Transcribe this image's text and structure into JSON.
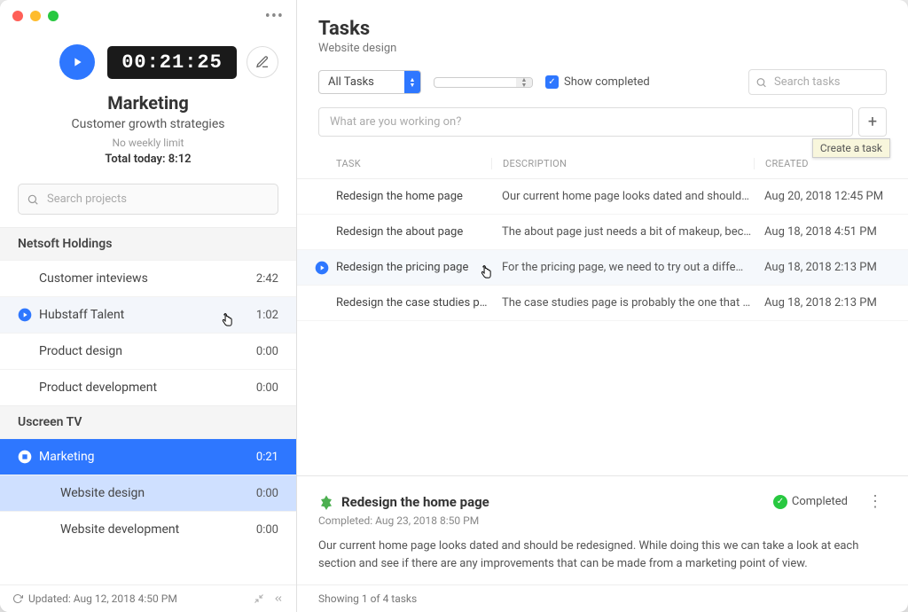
{
  "timer": {
    "display": "00:21:25"
  },
  "project_header": {
    "name": "Marketing",
    "desc": "Customer growth strategies",
    "limit": "No weekly limit",
    "total_label": "Total today: 8:12"
  },
  "search": {
    "projects_placeholder": "Search projects",
    "tasks_placeholder": "Search tasks"
  },
  "groups": [
    {
      "name": "Netsoft Holdings",
      "items": [
        {
          "label": "Customer inteviews",
          "time": "2:42",
          "playing": false
        },
        {
          "label": "Hubstaff Talent",
          "time": "1:02",
          "playing": true
        },
        {
          "label": "Product design",
          "time": "0:00",
          "playing": false
        },
        {
          "label": "Product development",
          "time": "0:00",
          "playing": false
        }
      ]
    },
    {
      "name": "Uscreen TV",
      "items": [
        {
          "label": "Marketing",
          "time": "0:21",
          "active": true
        },
        {
          "label": "Website design",
          "time": "0:00",
          "sub": true,
          "light": true
        },
        {
          "label": "Website development",
          "time": "0:00",
          "sub": true
        }
      ]
    }
  ],
  "sidebar_footer": {
    "updated": "Updated: Aug 12, 2018 4:50 PM"
  },
  "main": {
    "title": "Tasks",
    "subtitle": "Website design",
    "filter_all": "All Tasks",
    "show_completed": "Show completed",
    "working_placeholder": "What are you working on?",
    "tooltip": "Create a task"
  },
  "table": {
    "head_task": "Task",
    "head_desc": "Description",
    "head_created": "Created",
    "rows": [
      {
        "task": "Redesign the home page",
        "desc": "Our current home page looks dated and should…",
        "created": "Aug 20, 2018 12:45 PM"
      },
      {
        "task": "Redesign the about page",
        "desc": "The about page just needs a bit of makeup, bec…",
        "created": "Aug 18, 2018 4:51 PM"
      },
      {
        "task": "Redesign the pricing page",
        "desc": "For the pricing page, we need to try out a diffe…",
        "created": "Aug 18, 2018 2:13 PM",
        "playing": true
      },
      {
        "task": "Redesign the case studies pa…",
        "desc": "The case studies page is probably the one that …",
        "created": "Aug 18, 2018 2:13 PM"
      }
    ]
  },
  "detail": {
    "title": "Redesign the home page",
    "status": "Completed",
    "completed_text": "Completed: Aug 23, 2018 8:50 PM",
    "desc": "Our current home page looks dated and should be redesigned. While doing this we can take a look at each section and see if there are any improvements that can be made from a marketing point of view."
  },
  "main_footer": {
    "showing": "Showing 1 of 4 tasks"
  }
}
